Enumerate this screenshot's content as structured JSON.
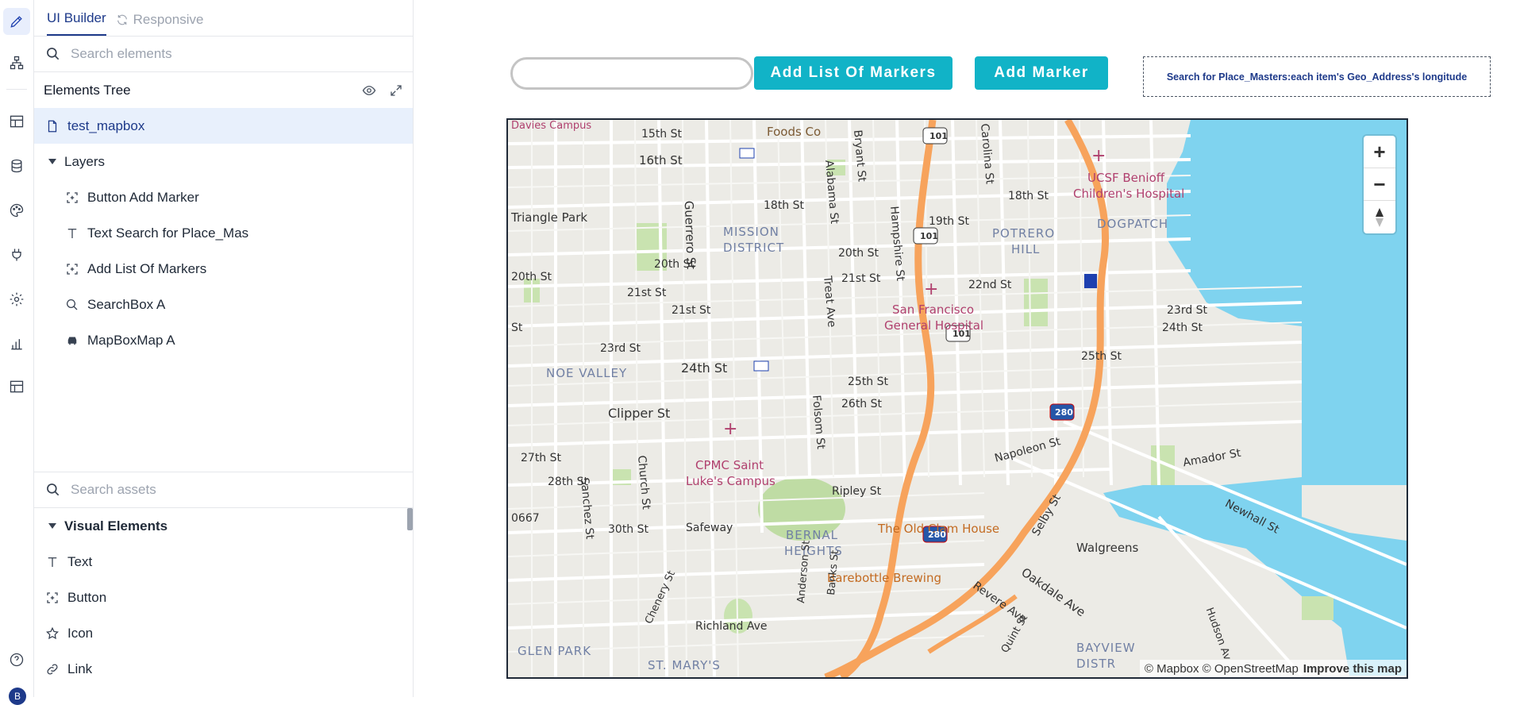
{
  "rail": {
    "icons": [
      "pencil-icon",
      "hierarchy-icon",
      "layout-icon",
      "database-icon",
      "palette-icon",
      "plug-icon",
      "gear-icon",
      "chart-icon",
      "table-icon",
      "help-icon"
    ],
    "avatar_letter": "B"
  },
  "panel": {
    "tabs": [
      {
        "label": "UI Builder",
        "active": true
      },
      {
        "label": "Responsive",
        "active": false
      }
    ],
    "search_elements_placeholder": "Search elements",
    "elements_tree_title": "Elements Tree",
    "page_item": "test_mapbox",
    "layers_label": "Layers",
    "layers": [
      {
        "label": "Button Add Marker",
        "icon": "button-icon"
      },
      {
        "label": "Text Search for Place_Mas",
        "icon": "text-icon"
      },
      {
        "label": "Add List Of Markers",
        "icon": "button-icon"
      },
      {
        "label": "SearchBox A",
        "icon": "search-icon"
      },
      {
        "label": "MapBoxMap A",
        "icon": "car-icon"
      }
    ],
    "search_assets_placeholder": "Search assets",
    "visual_elements_label": "Visual Elements",
    "visual_elements": [
      {
        "label": "Text",
        "icon": "text-icon"
      },
      {
        "label": "Button",
        "icon": "button-icon"
      },
      {
        "label": "Icon",
        "icon": "star-icon"
      },
      {
        "label": "Link",
        "icon": "link-icon"
      }
    ]
  },
  "canvas": {
    "add_list_button": "Add List Of Markers",
    "add_marker_button": "Add Marker",
    "search_text": "Search for Place_Masters:each item's Geo_Address's longitude",
    "map": {
      "zoom_in": "+",
      "zoom_out": "−",
      "attribution": "© Mapbox © OpenStreetMap",
      "improve": "Improve this map",
      "labels": {
        "l1": "Foods Co",
        "l2": "15th St",
        "l3": "16th St",
        "l4": "18th St",
        "l5": "Guerrero St",
        "l6": "MISSION",
        "l7": "DISTRICT",
        "l8": "Triangle Park",
        "l9": "20th St",
        "l10": "21st St",
        "l11": "23rd St",
        "l12": "24th St",
        "l13": "NOE VALLEY",
        "l14": "Clipper St",
        "l15": "27th St",
        "l16": "28th St",
        "l17": "30th St",
        "l18": "Sanchez St",
        "l19": "Church St",
        "l20": "CPMC Saint",
        "l21": "Luke's Campus",
        "l22": "Safeway",
        "l23": "BERNAL",
        "l24": "HEIGHTS",
        "l25": "Ripley St",
        "l26": "The Old Clam House",
        "l27": "Barebottle Brewing",
        "l28": "Richland Ave",
        "l29": "GLEN PARK",
        "l30": "ST. MARY'S",
        "l31": "Alabama St",
        "l32": "Bryant St",
        "l33": "Hampshire St",
        "l34": "Treat Ave",
        "l35": "Folsom St",
        "l36": "25th St",
        "l37": "26th St",
        "l38": "San Francisco",
        "l39": "General Hospital",
        "l40": "19th St",
        "l41": "22nd St",
        "l42": "POTRERO",
        "l43": "HILL",
        "l44": "DOGPATCH",
        "l45": "UCSF Benioff",
        "l46": "Children's Hospital",
        "l47": "Carolina St",
        "l48": "23rd St",
        "l49": "24th St",
        "l50": "25th St",
        "l51": "Napoleon St",
        "l52": "Amador St",
        "l53": "Newhall St",
        "l54": "Walgreens",
        "l55": "Oakdale Ave",
        "l56": "Selby St",
        "l57": "Revere Ave",
        "l58": "Quint St",
        "l59": "Hudson Av",
        "l60": "BAYVIEW",
        "l61": "DISTR",
        "l62": "101",
        "l63": "280",
        "l64": "Anderson St",
        "l65": "Banks St",
        "l66": "Chenery St",
        "l67": "0667",
        "l68": "18th St",
        "l69": "20th St",
        "l70": "21st St",
        "l71": "St",
        "l72": "20th St",
        "l73": "21st St",
        "l74": "Davies Campus"
      }
    }
  }
}
